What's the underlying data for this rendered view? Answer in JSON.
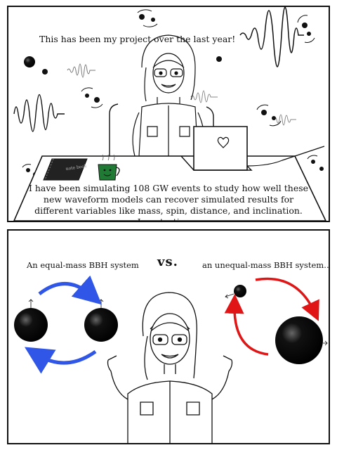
{
  "panel1": {
    "title": "This has been my project over the last year!",
    "notebook_label": "note book",
    "caption_lines": [
      "I have been simulating 108 GW events to study how well these",
      "new waveform models can recover simulated results for",
      "different variables like mass, spin, distance, and inclination.",
      "I am testing…"
    ]
  },
  "panel2": {
    "equal_label": "An equal-mass BBH system",
    "vs_label": "vs.",
    "unequal_label": "an unequal-mass BBH system…"
  },
  "colors": {
    "ink": "#111111",
    "arrow_blue": "#2f56e6",
    "arrow_red": "#e01616",
    "mug_green": "#1f7a34"
  }
}
